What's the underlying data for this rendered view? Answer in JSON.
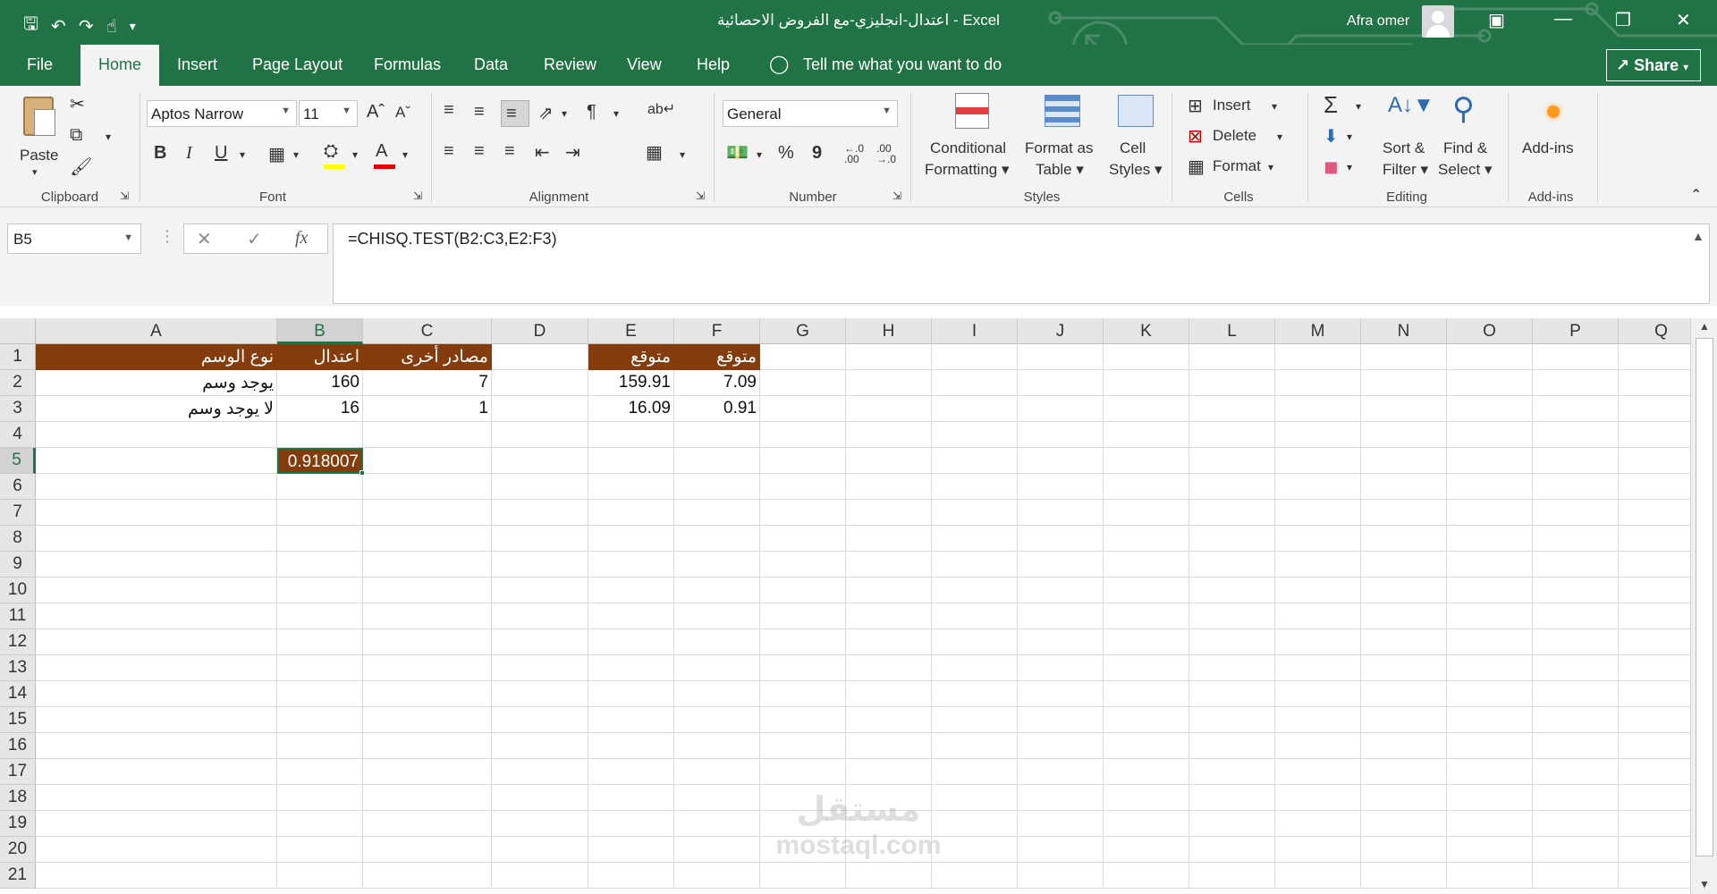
{
  "titlebar": {
    "title": "اعتدال-انجليزي-مع الفروض الاحصائية  -  Excel",
    "user": "Afra omer",
    "bg_color": "#217346",
    "qat_icons": [
      "save-icon",
      "undo-icon",
      "redo-icon",
      "touch-mode-icon",
      "customize-icon"
    ],
    "window_icons": [
      "ribbon-display-icon",
      "minimize-icon",
      "restore-icon",
      "close-icon"
    ]
  },
  "menu": {
    "tabs": [
      {
        "id": "file",
        "label": "File"
      },
      {
        "id": "home",
        "label": "Home"
      },
      {
        "id": "insert",
        "label": "Insert"
      },
      {
        "id": "page-layout",
        "label": "Page Layout"
      },
      {
        "id": "formulas",
        "label": "Formulas"
      },
      {
        "id": "data",
        "label": "Data"
      },
      {
        "id": "review",
        "label": "Review"
      },
      {
        "id": "view",
        "label": "View"
      },
      {
        "id": "help",
        "label": "Help"
      }
    ],
    "active_tab": "Home",
    "tell_me": "Tell me what you want to do",
    "share": "Share"
  },
  "ribbon": {
    "clipboard": {
      "paste": "Paste",
      "label": "Clipboard"
    },
    "font": {
      "name": "Aptos Narrow",
      "size": "11",
      "label": "Font",
      "bold": "B",
      "italic": "I",
      "underline": "U"
    },
    "alignment": {
      "label": "Alignment"
    },
    "number": {
      "format": "General",
      "label": "Number",
      "percent": "%",
      "comma": "9",
      "inc_decimal": "←.0\n.00",
      "dec_decimal": ".00\n→.0"
    },
    "styles": {
      "conditional": "Conditional\nFormatting",
      "format_table": "Format as\nTable",
      "cell_styles": "Cell\nStyles",
      "label": "Styles"
    },
    "cells": {
      "insert": "Insert",
      "delete": "Delete",
      "format": "Format",
      "label": "Cells"
    },
    "editing": {
      "sort": "Sort &\nFilter",
      "find": "Find &\nSelect",
      "label": "Editing"
    },
    "addins": {
      "button": "Add-ins",
      "label": "Add-ins"
    }
  },
  "formula_bar": {
    "name_box": "B5",
    "formula": "=CHISQ.TEST(B2:C3,E2:F3)"
  },
  "sheet": {
    "columns": [
      "A",
      "B",
      "C",
      "D",
      "E",
      "F",
      "G",
      "H",
      "I",
      "J",
      "K",
      "L",
      "M",
      "N",
      "O",
      "P",
      "Q"
    ],
    "rows": [
      "1",
      "2",
      "3",
      "4",
      "5",
      "6",
      "7",
      "8",
      "9",
      "10",
      "11",
      "12",
      "13",
      "14",
      "15",
      "16",
      "17",
      "18",
      "19",
      "20",
      "21"
    ],
    "selected_col": "B",
    "selected_row": "5",
    "header_fill": "#843c0c",
    "cells": {
      "A1": "نوع الوسم",
      "B1": "اعتدال",
      "C1": "مصادر أخرى",
      "E1": "متوقع",
      "F1": "متوقع",
      "A2": "يوجد وسم",
      "B2": "160",
      "C2": "7",
      "E2": "159.91",
      "F2": "7.09",
      "A3": "لا يوجد وسم",
      "B3": "16",
      "C3": "1",
      "E3": "16.09",
      "F3": "0.91",
      "B5": "0.918007"
    }
  },
  "watermark": {
    "arabic": "مستقل",
    "latin": "mostaql.com"
  }
}
